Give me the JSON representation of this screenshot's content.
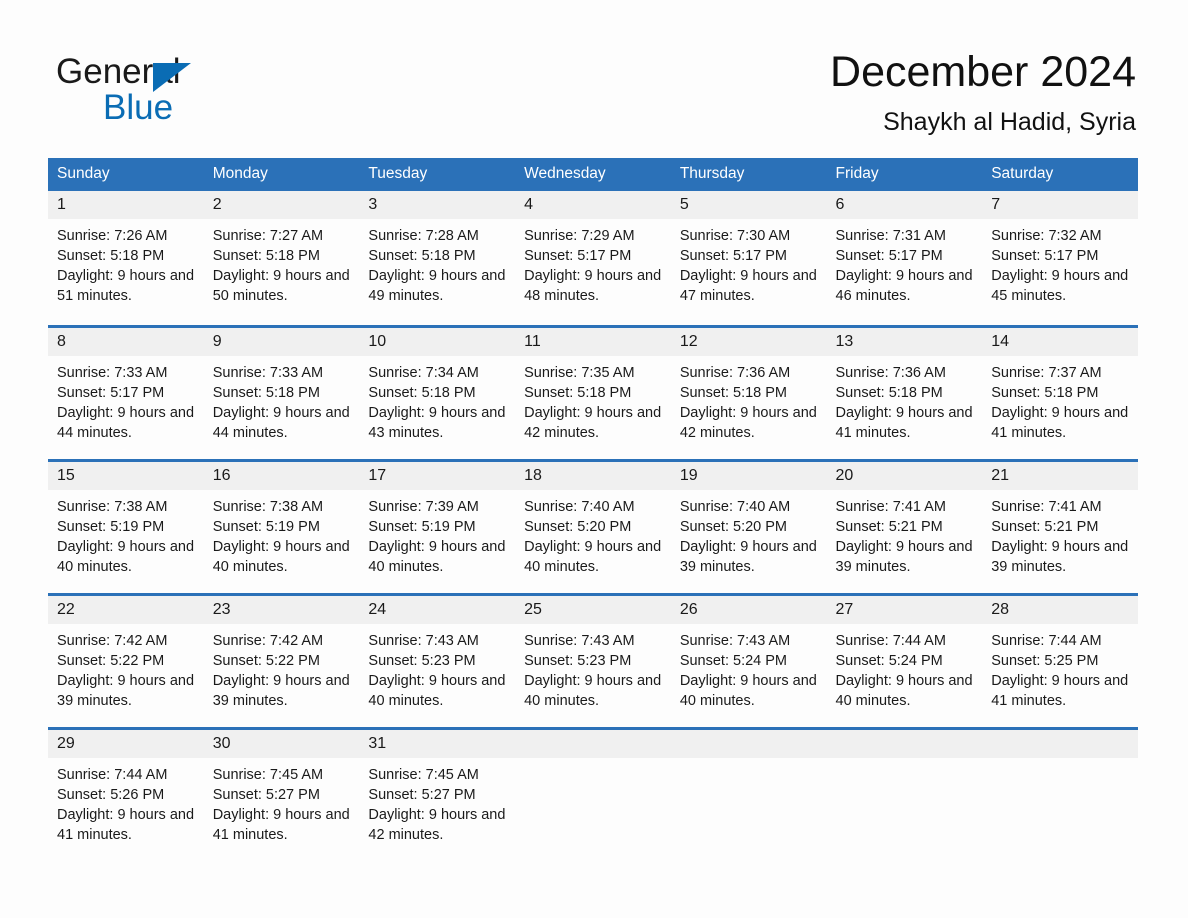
{
  "brand": {
    "name_part1": "General",
    "name_part2": "Blue",
    "accent_color": "#0a6cb4",
    "triangle_icon": "triangle-icon"
  },
  "header": {
    "title": "December 2024",
    "subtitle": "Shaykh al Hadid, Syria"
  },
  "theme": {
    "header_blue": "#2b71b8",
    "daynum_band": "#f0f0f0",
    "page_background": "#fdfdfd",
    "text": "#1a1a1a"
  },
  "calendar": {
    "weekday_headers": [
      "Sunday",
      "Monday",
      "Tuesday",
      "Wednesday",
      "Thursday",
      "Friday",
      "Saturday"
    ],
    "weeks": [
      [
        {
          "day": "1",
          "sunrise": "Sunrise: 7:26 AM",
          "sunset": "Sunset: 5:18 PM",
          "daylight": "Daylight: 9 hours and 51 minutes."
        },
        {
          "day": "2",
          "sunrise": "Sunrise: 7:27 AM",
          "sunset": "Sunset: 5:18 PM",
          "daylight": "Daylight: 9 hours and 50 minutes."
        },
        {
          "day": "3",
          "sunrise": "Sunrise: 7:28 AM",
          "sunset": "Sunset: 5:18 PM",
          "daylight": "Daylight: 9 hours and 49 minutes."
        },
        {
          "day": "4",
          "sunrise": "Sunrise: 7:29 AM",
          "sunset": "Sunset: 5:17 PM",
          "daylight": "Daylight: 9 hours and 48 minutes."
        },
        {
          "day": "5",
          "sunrise": "Sunrise: 7:30 AM",
          "sunset": "Sunset: 5:17 PM",
          "daylight": "Daylight: 9 hours and 47 minutes."
        },
        {
          "day": "6",
          "sunrise": "Sunrise: 7:31 AM",
          "sunset": "Sunset: 5:17 PM",
          "daylight": "Daylight: 9 hours and 46 minutes."
        },
        {
          "day": "7",
          "sunrise": "Sunrise: 7:32 AM",
          "sunset": "Sunset: 5:17 PM",
          "daylight": "Daylight: 9 hours and 45 minutes."
        }
      ],
      [
        {
          "day": "8",
          "sunrise": "Sunrise: 7:33 AM",
          "sunset": "Sunset: 5:17 PM",
          "daylight": "Daylight: 9 hours and 44 minutes."
        },
        {
          "day": "9",
          "sunrise": "Sunrise: 7:33 AM",
          "sunset": "Sunset: 5:18 PM",
          "daylight": "Daylight: 9 hours and 44 minutes."
        },
        {
          "day": "10",
          "sunrise": "Sunrise: 7:34 AM",
          "sunset": "Sunset: 5:18 PM",
          "daylight": "Daylight: 9 hours and 43 minutes."
        },
        {
          "day": "11",
          "sunrise": "Sunrise: 7:35 AM",
          "sunset": "Sunset: 5:18 PM",
          "daylight": "Daylight: 9 hours and 42 minutes."
        },
        {
          "day": "12",
          "sunrise": "Sunrise: 7:36 AM",
          "sunset": "Sunset: 5:18 PM",
          "daylight": "Daylight: 9 hours and 42 minutes."
        },
        {
          "day": "13",
          "sunrise": "Sunrise: 7:36 AM",
          "sunset": "Sunset: 5:18 PM",
          "daylight": "Daylight: 9 hours and 41 minutes."
        },
        {
          "day": "14",
          "sunrise": "Sunrise: 7:37 AM",
          "sunset": "Sunset: 5:18 PM",
          "daylight": "Daylight: 9 hours and 41 minutes."
        }
      ],
      [
        {
          "day": "15",
          "sunrise": "Sunrise: 7:38 AM",
          "sunset": "Sunset: 5:19 PM",
          "daylight": "Daylight: 9 hours and 40 minutes."
        },
        {
          "day": "16",
          "sunrise": "Sunrise: 7:38 AM",
          "sunset": "Sunset: 5:19 PM",
          "daylight": "Daylight: 9 hours and 40 minutes."
        },
        {
          "day": "17",
          "sunrise": "Sunrise: 7:39 AM",
          "sunset": "Sunset: 5:19 PM",
          "daylight": "Daylight: 9 hours and 40 minutes."
        },
        {
          "day": "18",
          "sunrise": "Sunrise: 7:40 AM",
          "sunset": "Sunset: 5:20 PM",
          "daylight": "Daylight: 9 hours and 40 minutes."
        },
        {
          "day": "19",
          "sunrise": "Sunrise: 7:40 AM",
          "sunset": "Sunset: 5:20 PM",
          "daylight": "Daylight: 9 hours and 39 minutes."
        },
        {
          "day": "20",
          "sunrise": "Sunrise: 7:41 AM",
          "sunset": "Sunset: 5:21 PM",
          "daylight": "Daylight: 9 hours and 39 minutes."
        },
        {
          "day": "21",
          "sunrise": "Sunrise: 7:41 AM",
          "sunset": "Sunset: 5:21 PM",
          "daylight": "Daylight: 9 hours and 39 minutes."
        }
      ],
      [
        {
          "day": "22",
          "sunrise": "Sunrise: 7:42 AM",
          "sunset": "Sunset: 5:22 PM",
          "daylight": "Daylight: 9 hours and 39 minutes."
        },
        {
          "day": "23",
          "sunrise": "Sunrise: 7:42 AM",
          "sunset": "Sunset: 5:22 PM",
          "daylight": "Daylight: 9 hours and 39 minutes."
        },
        {
          "day": "24",
          "sunrise": "Sunrise: 7:43 AM",
          "sunset": "Sunset: 5:23 PM",
          "daylight": "Daylight: 9 hours and 40 minutes."
        },
        {
          "day": "25",
          "sunrise": "Sunrise: 7:43 AM",
          "sunset": "Sunset: 5:23 PM",
          "daylight": "Daylight: 9 hours and 40 minutes."
        },
        {
          "day": "26",
          "sunrise": "Sunrise: 7:43 AM",
          "sunset": "Sunset: 5:24 PM",
          "daylight": "Daylight: 9 hours and 40 minutes."
        },
        {
          "day": "27",
          "sunrise": "Sunrise: 7:44 AM",
          "sunset": "Sunset: 5:24 PM",
          "daylight": "Daylight: 9 hours and 40 minutes."
        },
        {
          "day": "28",
          "sunrise": "Sunrise: 7:44 AM",
          "sunset": "Sunset: 5:25 PM",
          "daylight": "Daylight: 9 hours and 41 minutes."
        }
      ],
      [
        {
          "day": "29",
          "sunrise": "Sunrise: 7:44 AM",
          "sunset": "Sunset: 5:26 PM",
          "daylight": "Daylight: 9 hours and 41 minutes."
        },
        {
          "day": "30",
          "sunrise": "Sunrise: 7:45 AM",
          "sunset": "Sunset: 5:27 PM",
          "daylight": "Daylight: 9 hours and 41 minutes."
        },
        {
          "day": "31",
          "sunrise": "Sunrise: 7:45 AM",
          "sunset": "Sunset: 5:27 PM",
          "daylight": "Daylight: 9 hours and 42 minutes."
        },
        {
          "day": "",
          "sunrise": "",
          "sunset": "",
          "daylight": ""
        },
        {
          "day": "",
          "sunrise": "",
          "sunset": "",
          "daylight": ""
        },
        {
          "day": "",
          "sunrise": "",
          "sunset": "",
          "daylight": ""
        },
        {
          "day": "",
          "sunrise": "",
          "sunset": "",
          "daylight": ""
        }
      ]
    ]
  }
}
